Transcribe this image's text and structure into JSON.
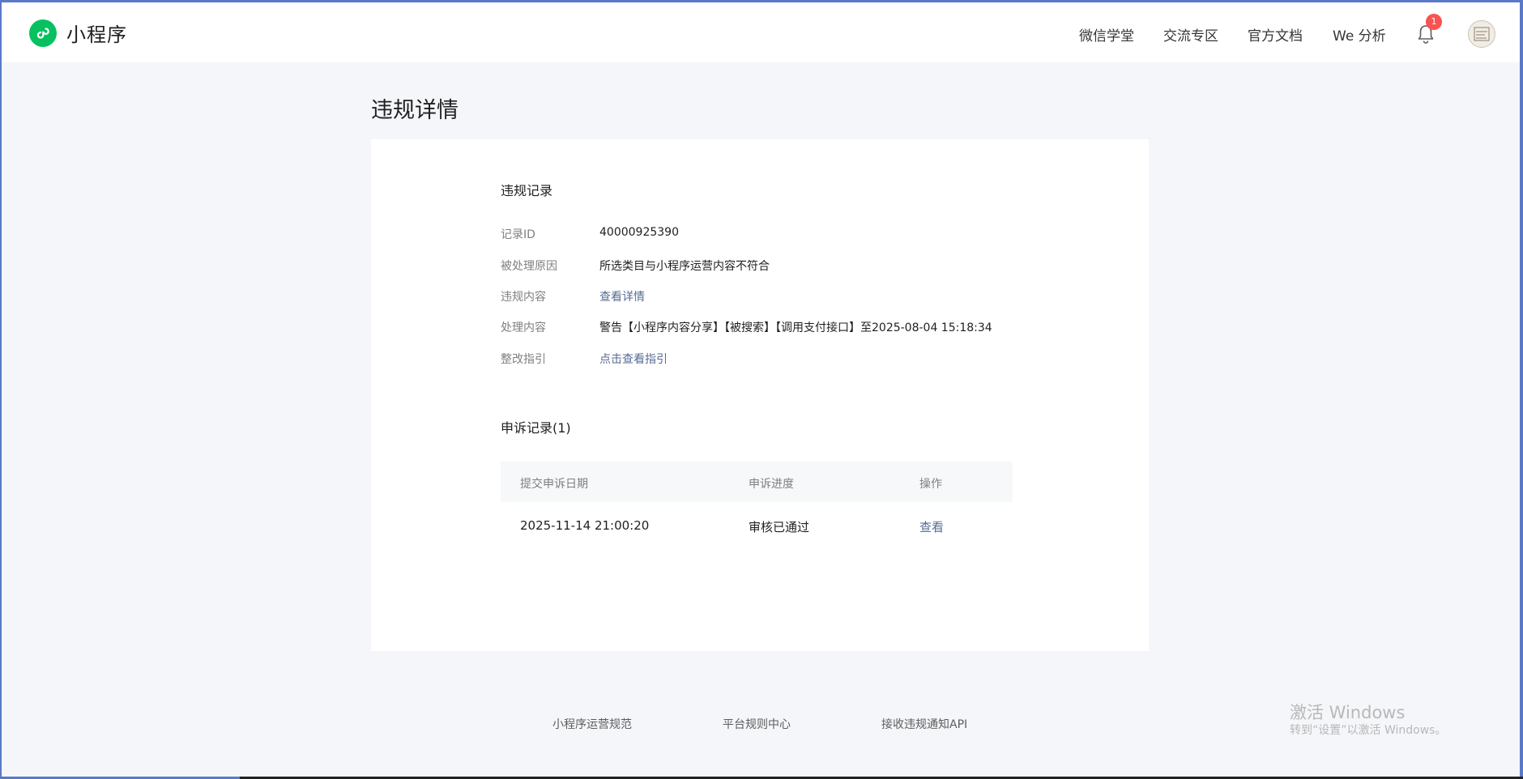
{
  "header": {
    "brand": "小程序",
    "nav": [
      "微信学堂",
      "交流专区",
      "官方文档",
      "We 分析"
    ],
    "notification_count": "1"
  },
  "page": {
    "title": "违规详情"
  },
  "violation": {
    "section_title": "违规记录",
    "rows": [
      {
        "label": "记录ID",
        "value": "40000925390"
      },
      {
        "label": "被处理原因",
        "value": "所选类目与小程序运营内容不符合"
      },
      {
        "label": "违规内容",
        "value": "查看详情"
      },
      {
        "label": "处理内容",
        "value": "警告【小程序内容分享】【被搜索】【调用支付接口】至2025-08-04 15:18:34"
      },
      {
        "label": "整改指引",
        "value": "点击查看指引"
      }
    ]
  },
  "appeal": {
    "section_title": "申诉记录(1)",
    "columns": [
      "提交申诉日期",
      "申诉进度",
      "操作"
    ],
    "rows": [
      {
        "date": "2025-11-14 21:00:20",
        "status": "审核已通过",
        "action": "查看"
      }
    ]
  },
  "footer": {
    "links": [
      "小程序运营规范",
      "平台规则中心",
      "接收违规通知API"
    ]
  },
  "watermark": {
    "line1": "激活 Windows",
    "line2": "转到“设置”以激活 Windows。"
  },
  "colors": {
    "brand_green": "#07c160",
    "link": "#576b95",
    "badge": "#fa5151",
    "background": "#f4f6f9"
  }
}
